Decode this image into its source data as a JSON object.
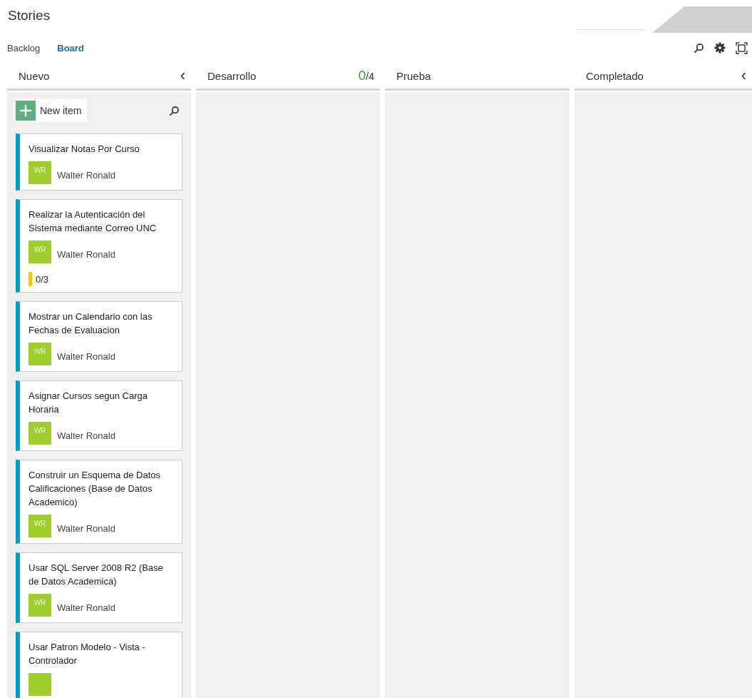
{
  "title": "Stories",
  "tabs": [
    {
      "label": "Backlog",
      "selected": false
    },
    {
      "label": "Board",
      "selected": true
    }
  ],
  "columns": [
    {
      "name": "Nuevo",
      "collapse": "‹",
      "new_item": "New item",
      "cards": [
        {
          "title": "Visualizar Notas Por Curso",
          "owner": {
            "initials": "WR",
            "name": "Walter Ronald"
          }
        },
        {
          "title": "Realizar la Autenticación del Sistema mediante Correo UNC",
          "owner": {
            "initials": "WR",
            "name": "Walter Ronald"
          },
          "tasks": "0/3"
        },
        {
          "title": "Mostrar un Calendario con las Fechas de Evaluacion",
          "owner": {
            "initials": "WR",
            "name": "Walter Ronald"
          }
        },
        {
          "title": "Asignar Cursos segun Carga Horaria",
          "owner": {
            "initials": "WR",
            "name": "Walter Ronald"
          }
        },
        {
          "title": "Construir un Esquema de Datos Calificaciones (Base de Datos Academico)",
          "owner": {
            "initials": "WR",
            "name": "Walter Ronald"
          }
        },
        {
          "title": "Usar SQL Server 2008 R2 (Base de Datos Academica)",
          "owner": {
            "initials": "WR",
            "name": "Walter Ronald"
          }
        },
        {
          "title": "Usar Patron Modelo - Vista - Controlador",
          "avatar_only": true
        }
      ]
    },
    {
      "name": "Desarrollo",
      "count": "0",
      "limit": "/4"
    },
    {
      "name": "Prueba"
    },
    {
      "name": "Completado",
      "collapse": "‹"
    }
  ]
}
